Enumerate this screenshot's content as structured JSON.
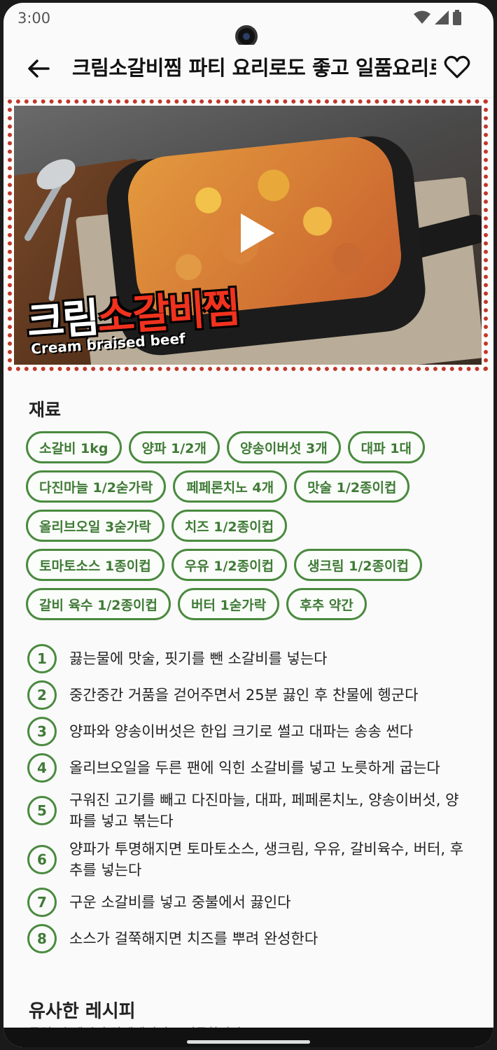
{
  "status": {
    "time": "3:00"
  },
  "header": {
    "title": "크림소갈비찜    파티 요리로도 좋고 일품요리로도 좋은 크림소갈비찜"
  },
  "video": {
    "overlay_title_white": "크림",
    "overlay_title_red": "소갈비찜",
    "overlay_subtitle": "Cream braised beef"
  },
  "ingredients": {
    "title": "재료",
    "rows": [
      [
        "소갈비 1kg",
        "양파 1/2개",
        "양송이버섯 3개",
        "대파 1대"
      ],
      [
        "다진마늘 1/2숟가락",
        "페페론치노 4개",
        "맛술 1/2종이컵"
      ],
      [
        "올리브오일 3숟가락",
        "치즈 1/2종이컵"
      ],
      [
        "토마토소스 1종이컵",
        "우유 1/2종이컵",
        "생크림 1/2종이컵"
      ],
      [
        "갈비 육수 1/2종이컵",
        "버터 1숟가락",
        "후추 약간"
      ]
    ]
  },
  "steps": [
    {
      "num": "1",
      "text": "끓는물에 맛술, 핏기를 뺀 소갈비를 넣는다"
    },
    {
      "num": "2",
      "text": "중간중간 거품을 걷어주면서 25분 끓인 후 찬물에 헹군다"
    },
    {
      "num": "3",
      "text": "양파와 양송이버섯은 한입 크기로 썰고 대파는 송송 썬다"
    },
    {
      "num": "4",
      "text": "올리브오일을 두른 팬에 익힌 소갈비를 넣고 노릇하게 굽는다"
    },
    {
      "num": "5",
      "text": "구워진 고기를 빼고 다진마늘, 대파, 페페론치노, 양송이버섯, 양파를 넣고 볶는다"
    },
    {
      "num": "6",
      "text": "양파가 투명해지면 토마토소스, 생크림, 우유, 갈비육수, 버터, 후추를 넣는다"
    },
    {
      "num": "7",
      "text": "구운 소갈비를 넣고 중불에서 끓인다"
    },
    {
      "num": "8",
      "text": "소스가 걸쭉해지면 치즈를 뿌려 완성한다"
    }
  ],
  "similar": {
    "title": "유사한 레시피",
    "subtitle": "클릭 시 레시피 상세페이지로 이동합니다"
  },
  "colors": {
    "accent": "#4a8a3f",
    "frame": "#c0392b"
  }
}
